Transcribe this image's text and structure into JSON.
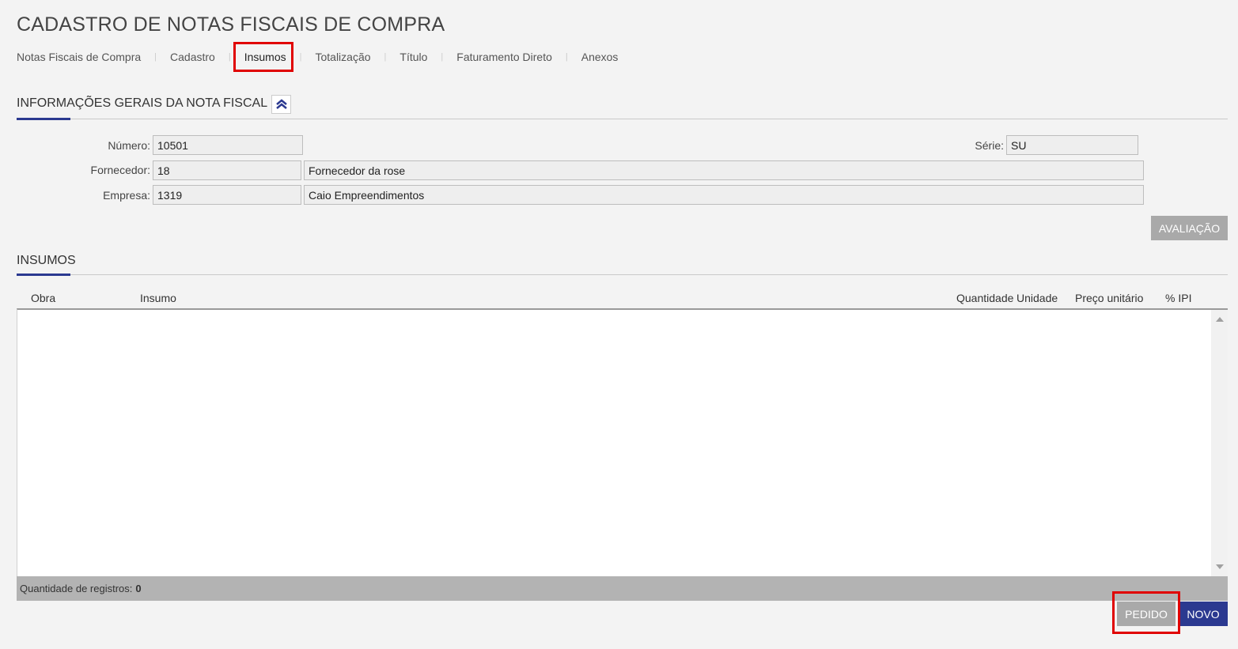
{
  "page": {
    "title": "CADASTRO DE NOTAS FISCAIS DE COMPRA"
  },
  "tabs": [
    {
      "label": "Notas Fiscais de Compra",
      "active": false
    },
    {
      "label": "Cadastro",
      "active": false
    },
    {
      "label": "Insumos",
      "active": true
    },
    {
      "label": "Totalização",
      "active": false
    },
    {
      "label": "Título",
      "active": false
    },
    {
      "label": "Faturamento Direto",
      "active": false
    },
    {
      "label": "Anexos",
      "active": false
    }
  ],
  "tab_separator": "|",
  "general_info": {
    "title": "INFORMAÇÕES GERAIS DA NOTA FISCAL",
    "collapse_icon": "double-chevron-up-icon",
    "numero_label": "Número:",
    "numero_value": "10501",
    "serie_label": "Série:",
    "serie_value": "SU",
    "fornecedor_label": "Fornecedor:",
    "fornecedor_code": "18",
    "fornecedor_name": "Fornecedor da rose",
    "empresa_label": "Empresa:",
    "empresa_code": "1319",
    "empresa_name": "Caio Empreendimentos",
    "avaliacao_label": "AVALIAÇÃO"
  },
  "insumos": {
    "title": "INSUMOS",
    "columns": [
      "Obra",
      "Insumo",
      "Quantidade",
      "Unidade",
      "Preço unitário",
      "% IPI"
    ],
    "rows": [],
    "count_label": "Quantidade de registros:",
    "count_value": "0",
    "pedido_label": "PEDIDO",
    "novo_label": "NOVO"
  },
  "colors": {
    "accent": "#2b3990",
    "highlight": "#e00000",
    "button_gray": "#a9a9a9",
    "background": "#f3f3f3"
  }
}
